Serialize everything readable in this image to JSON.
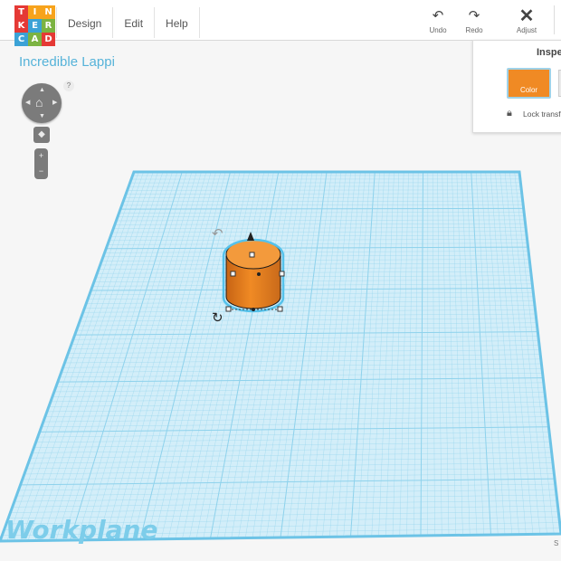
{
  "app": {
    "logo_letters": [
      "T",
      "I",
      "N",
      "K",
      "E",
      "R",
      "C",
      "A",
      "D"
    ],
    "logo_colors": [
      "#e53935",
      "#f7a31c",
      "#f7a31c",
      "#e53935",
      "#3ba2d6",
      "#7cb342",
      "#3ba2d6",
      "#7cb342",
      "#e53935"
    ]
  },
  "menu": {
    "design": "Design",
    "edit": "Edit",
    "help": "Help"
  },
  "toolbar": {
    "undo_label": "Undo",
    "redo_label": "Redo",
    "adjust_label": "Adjust",
    "undo_icon": "undo-arrow-icon",
    "redo_icon": "redo-arrow-icon",
    "adjust_icon": "adjust-tools-icon"
  },
  "design": {
    "title": "Incredible Lappi"
  },
  "controls": {
    "help_symbol": "?",
    "zoom_in_symbol": "+",
    "zoom_out_symbol": "−"
  },
  "inspector": {
    "title": "Inspe",
    "color_label": "Color",
    "selected_color": "#f08a24",
    "lock_label": "Lock transf"
  },
  "workplane": {
    "label": "Workplane",
    "corner_label": "S",
    "grid_color": "#8ed2ec",
    "plane_color": "#d3eef9",
    "label_color": "#7dcdea"
  },
  "shape": {
    "type": "cylinder",
    "color": "#f08a24",
    "selected": true
  }
}
